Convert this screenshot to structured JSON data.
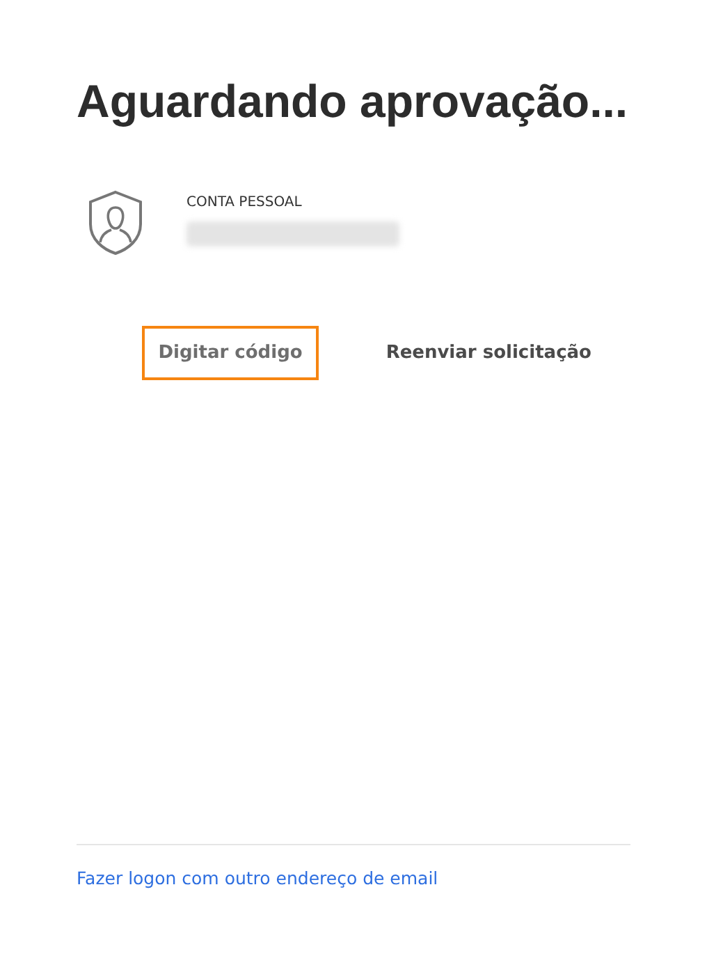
{
  "title": "Aguardando aprovação...",
  "account": {
    "label": "CONTA PESSOAL",
    "email_hidden": true
  },
  "buttons": [
    {
      "label": "Digitar código",
      "focused": true
    },
    {
      "label": "Reenviar solicitação",
      "focused": false
    }
  ],
  "footer_link": "Fazer logon com outro endereço de email"
}
